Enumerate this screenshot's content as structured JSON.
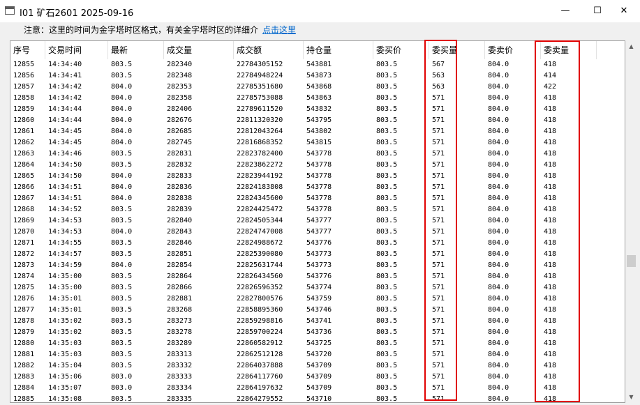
{
  "window": {
    "title": "I01 矿石2601 2025-09-16",
    "minimize": "—",
    "maximize": "☐",
    "close": "✕"
  },
  "notice": {
    "text": "注意：这里的时间为金字塔时区格式，有关金字塔时区的详细介",
    "link": "点击这里"
  },
  "columns": [
    "序号",
    "交易时间",
    "最新",
    "成交量",
    "成交额",
    "持仓量",
    "委买价",
    "委买量",
    "委卖价",
    "委卖量"
  ],
  "rows": [
    [
      "12855",
      "14:34:40",
      "803.5",
      "282340",
      "22784305152",
      "543881",
      "803.5",
      "567",
      "804.0",
      "418"
    ],
    [
      "12856",
      "14:34:41",
      "803.5",
      "282348",
      "22784948224",
      "543873",
      "803.5",
      "563",
      "804.0",
      "414"
    ],
    [
      "12857",
      "14:34:42",
      "804.0",
      "282353",
      "22785351680",
      "543868",
      "803.5",
      "563",
      "804.0",
      "422"
    ],
    [
      "12858",
      "14:34:42",
      "804.0",
      "282358",
      "22785753088",
      "543863",
      "803.5",
      "571",
      "804.0",
      "418"
    ],
    [
      "12859",
      "14:34:44",
      "804.0",
      "282406",
      "22789611520",
      "543832",
      "803.5",
      "571",
      "804.0",
      "418"
    ],
    [
      "12860",
      "14:34:44",
      "804.0",
      "282676",
      "22811320320",
      "543795",
      "803.5",
      "571",
      "804.0",
      "418"
    ],
    [
      "12861",
      "14:34:45",
      "804.0",
      "282685",
      "22812043264",
      "543802",
      "803.5",
      "571",
      "804.0",
      "418"
    ],
    [
      "12862",
      "14:34:45",
      "804.0",
      "282745",
      "22816868352",
      "543815",
      "803.5",
      "571",
      "804.0",
      "418"
    ],
    [
      "12863",
      "14:34:46",
      "803.5",
      "282831",
      "22823782400",
      "543778",
      "803.5",
      "571",
      "804.0",
      "418"
    ],
    [
      "12864",
      "14:34:50",
      "803.5",
      "282832",
      "22823862272",
      "543778",
      "803.5",
      "571",
      "804.0",
      "418"
    ],
    [
      "12865",
      "14:34:50",
      "804.0",
      "282833",
      "22823944192",
      "543778",
      "803.5",
      "571",
      "804.0",
      "418"
    ],
    [
      "12866",
      "14:34:51",
      "804.0",
      "282836",
      "22824183808",
      "543778",
      "803.5",
      "571",
      "804.0",
      "418"
    ],
    [
      "12867",
      "14:34:51",
      "804.0",
      "282838",
      "22824345600",
      "543778",
      "803.5",
      "571",
      "804.0",
      "418"
    ],
    [
      "12868",
      "14:34:52",
      "803.5",
      "282839",
      "22824425472",
      "543778",
      "803.5",
      "571",
      "804.0",
      "418"
    ],
    [
      "12869",
      "14:34:53",
      "803.5",
      "282840",
      "22824505344",
      "543777",
      "803.5",
      "571",
      "804.0",
      "418"
    ],
    [
      "12870",
      "14:34:53",
      "804.0",
      "282843",
      "22824747008",
      "543777",
      "803.5",
      "571",
      "804.0",
      "418"
    ],
    [
      "12871",
      "14:34:55",
      "803.5",
      "282846",
      "22824988672",
      "543776",
      "803.5",
      "571",
      "804.0",
      "418"
    ],
    [
      "12872",
      "14:34:57",
      "803.5",
      "282851",
      "22825390080",
      "543773",
      "803.5",
      "571",
      "804.0",
      "418"
    ],
    [
      "12873",
      "14:34:59",
      "804.0",
      "282854",
      "22825631744",
      "543773",
      "803.5",
      "571",
      "804.0",
      "418"
    ],
    [
      "12874",
      "14:35:00",
      "803.5",
      "282864",
      "22826434560",
      "543776",
      "803.5",
      "571",
      "804.0",
      "418"
    ],
    [
      "12875",
      "14:35:00",
      "803.5",
      "282866",
      "22826596352",
      "543774",
      "803.5",
      "571",
      "804.0",
      "418"
    ],
    [
      "12876",
      "14:35:01",
      "803.5",
      "282881",
      "22827800576",
      "543759",
      "803.5",
      "571",
      "804.0",
      "418"
    ],
    [
      "12877",
      "14:35:01",
      "803.5",
      "283268",
      "22858895360",
      "543746",
      "803.5",
      "571",
      "804.0",
      "418"
    ],
    [
      "12878",
      "14:35:02",
      "803.5",
      "283273",
      "22859298816",
      "543741",
      "803.5",
      "571",
      "804.0",
      "418"
    ],
    [
      "12879",
      "14:35:02",
      "803.5",
      "283278",
      "22859700224",
      "543736",
      "803.5",
      "571",
      "804.0",
      "418"
    ],
    [
      "12880",
      "14:35:03",
      "803.5",
      "283289",
      "22860582912",
      "543725",
      "803.5",
      "571",
      "804.0",
      "418"
    ],
    [
      "12881",
      "14:35:03",
      "803.5",
      "283313",
      "22862512128",
      "543720",
      "803.5",
      "571",
      "804.0",
      "418"
    ],
    [
      "12882",
      "14:35:04",
      "803.5",
      "283332",
      "22864037888",
      "543709",
      "803.5",
      "571",
      "804.0",
      "418"
    ],
    [
      "12883",
      "14:35:06",
      "803.0",
      "283333",
      "22864117760",
      "543709",
      "803.5",
      "571",
      "804.0",
      "418"
    ],
    [
      "12884",
      "14:35:07",
      "803.0",
      "283334",
      "22864197632",
      "543709",
      "803.5",
      "571",
      "804.0",
      "418"
    ],
    [
      "12885",
      "14:35:08",
      "803.5",
      "283335",
      "22864279552",
      "543710",
      "803.5",
      "571",
      "804.0",
      "418"
    ]
  ]
}
